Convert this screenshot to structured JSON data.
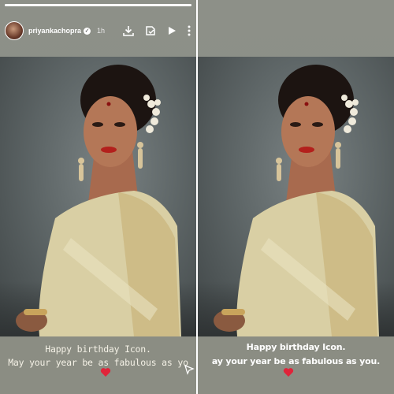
{
  "left_story": {
    "username": "priyankachopra",
    "time_ago": "1h",
    "progress_segments": [
      1,
      0,
      0
    ],
    "icons": [
      "download-icon",
      "stamp-icon",
      "play-icon",
      "more-icon"
    ],
    "caption_line1": "Happy birthday Icon.",
    "caption_line2": "May your year be as fabulous as yo",
    "caption_emoji": "❤️"
  },
  "right_story": {
    "caption_line1": "Happy birthday Icon.",
    "caption_line2": "ay your year be as fabulous as you.",
    "caption_emoji": "❤️"
  },
  "colors": {
    "story_background": "#8b8d83",
    "saree_gold": "#d9cfa4",
    "lip_red": "#b3201c",
    "heart_red": "#e0243a"
  }
}
